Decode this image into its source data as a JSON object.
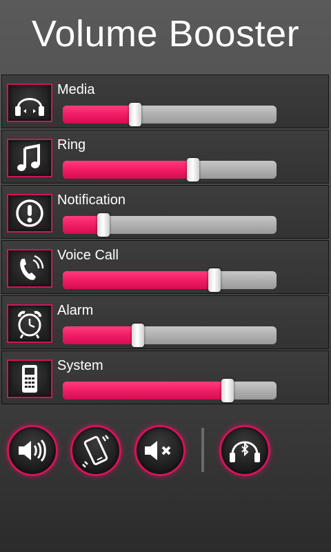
{
  "app": {
    "title": "Volume Booster"
  },
  "colors": {
    "accent": "#ef1a63",
    "track": "#b0b0b0",
    "background": "#4a4a4a"
  },
  "volumes": [
    {
      "label": "Media",
      "icon": "headphones-icon",
      "level": 0.34
    },
    {
      "label": "Ring",
      "icon": "music-note-icon",
      "level": 0.61
    },
    {
      "label": "Notification",
      "icon": "exclamation-icon",
      "level": 0.19
    },
    {
      "label": "Voice Call",
      "icon": "phone-call-icon",
      "level": 0.71
    },
    {
      "label": "Alarm",
      "icon": "alarm-clock-icon",
      "level": 0.35
    },
    {
      "label": "System",
      "icon": "mobile-phone-icon",
      "level": 0.77
    }
  ],
  "bottom_buttons": [
    {
      "icon": "speaker-loud-icon"
    },
    {
      "icon": "vibrate-phone-icon"
    },
    {
      "icon": "speaker-mute-icon"
    },
    {
      "icon": "bluetooth-headphones-icon"
    }
  ]
}
